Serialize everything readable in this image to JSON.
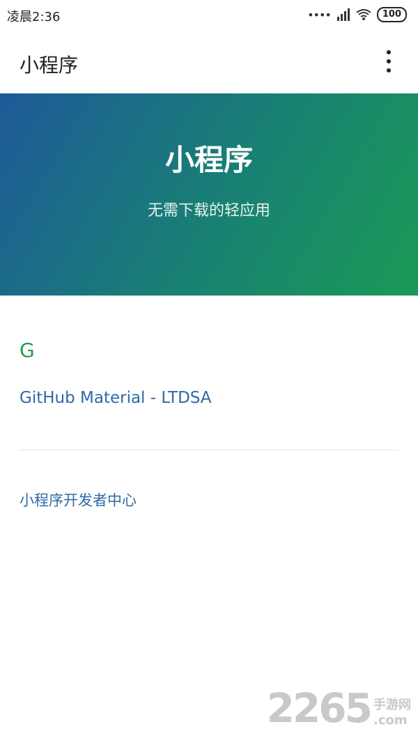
{
  "status": {
    "time": "凌晨2:36",
    "battery": "100"
  },
  "appbar": {
    "title": "小程序"
  },
  "hero": {
    "title": "小程序",
    "subtitle": "无需下载的轻应用"
  },
  "list": {
    "section_letter": "G",
    "items": [
      {
        "label": "GitHub Material - LTDSA"
      }
    ],
    "footer_link": "小程序开发者中心"
  },
  "watermark": {
    "number": "2265",
    "text_top": "手游网",
    "text_bottom": ".com"
  }
}
